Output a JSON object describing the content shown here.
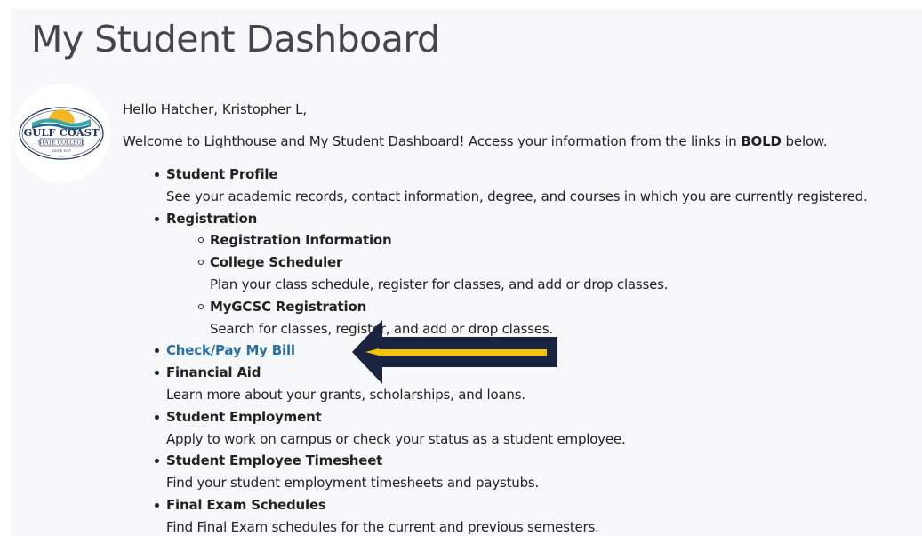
{
  "page": {
    "title": "My Student Dashboard"
  },
  "logo": {
    "line1": "GULF COAST",
    "line2": "STATE COLLEGE",
    "line3": "SINCE 1957",
    "colors": {
      "navy": "#1f2f5c",
      "teal": "#39a7a8",
      "sun": "#f3b626"
    }
  },
  "greeting": "Hello Hatcher, Kristopher L,",
  "welcome": {
    "before": "Welcome to Lighthouse and My Student Dashboard! Access your information from the links in ",
    "bold": "BOLD",
    "after": " below."
  },
  "menu": {
    "student_profile": {
      "label": "Student Profile",
      "desc": "See your academic records, contact information, degree, and courses in which you are currently registered."
    },
    "registration": {
      "label": "Registration",
      "sub": {
        "info": {
          "label": "Registration Information"
        },
        "scheduler": {
          "label": "College Scheduler",
          "desc": "Plan your class schedule, register for classes, and add or drop classes."
        },
        "mygcsc": {
          "label": "MyGCSC Registration",
          "desc": "Search for classes, register, and add or drop classes."
        }
      }
    },
    "check_pay": {
      "label": "Check/Pay My Bill"
    },
    "financial_aid": {
      "label": "Financial Aid",
      "desc": "Learn more about your grants, scholarships, and loans."
    },
    "student_employment": {
      "label": "Student Employment",
      "desc": "Apply to work on campus or check your status as a student employee."
    },
    "timesheet": {
      "label": "Student Employee Timesheet",
      "desc": "Find your student employment timesheets and paystubs."
    },
    "final_exams": {
      "label": "Final Exam Schedules",
      "desc": "Find Final Exam schedules for the current and previous semesters."
    }
  },
  "colors": {
    "link": "#2b6ea4",
    "arrow_outline": "#1a2440",
    "arrow_fill": "#f5c400"
  }
}
